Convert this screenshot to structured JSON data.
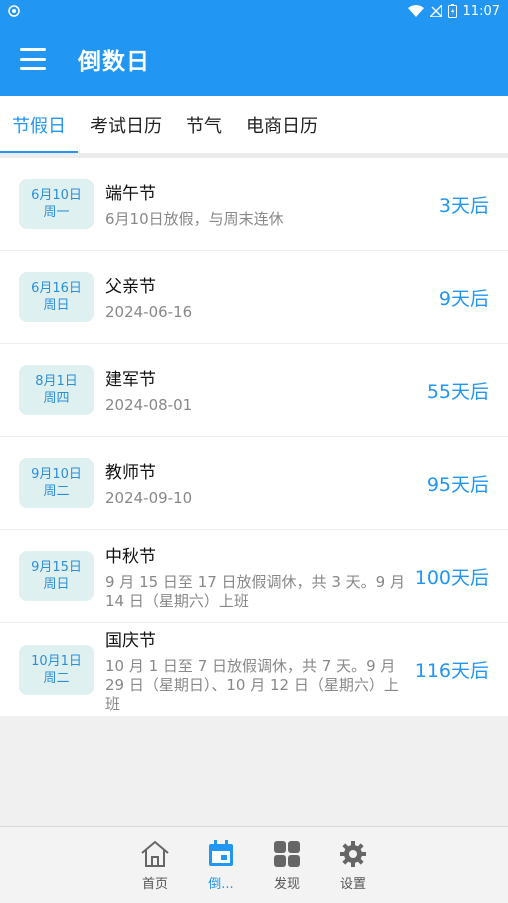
{
  "status": {
    "time": "11:07"
  },
  "app": {
    "title": "倒数日"
  },
  "tabs": [
    "节假日",
    "考试日历",
    "节气",
    "电商日历"
  ],
  "holidays": [
    {
      "date": "6月10日",
      "weekday": "周一",
      "name": "端午节",
      "desc": "6月10日放假，与周末连休",
      "days": "3天后"
    },
    {
      "date": "6月16日",
      "weekday": "周日",
      "name": "父亲节",
      "desc": "2024-06-16",
      "days": "9天后"
    },
    {
      "date": "8月1日",
      "weekday": "周四",
      "name": "建军节",
      "desc": "2024-08-01",
      "days": "55天后"
    },
    {
      "date": "9月10日",
      "weekday": "周二",
      "name": "教师节",
      "desc": "2024-09-10",
      "days": "95天后"
    },
    {
      "date": "9月15日",
      "weekday": "周日",
      "name": "中秋节",
      "desc": "9 月 15 日至 17 日放假调休，共 3 天。9 月 14 日（星期六）上班",
      "days": "100天后"
    },
    {
      "date": "10月1日",
      "weekday": "周二",
      "name": "国庆节",
      "desc": "10 月 1 日至 7 日放假调休，共 7 天。9 月 29 日（星期日）、10 月 12 日（星期六）上班",
      "days": "116天后"
    }
  ],
  "nav": [
    {
      "label": "首页",
      "icon": "home-icon"
    },
    {
      "label": "倒...",
      "icon": "calendar-icon"
    },
    {
      "label": "发现",
      "icon": "grid-icon"
    },
    {
      "label": "设置",
      "icon": "gear-icon"
    }
  ],
  "colors": {
    "primary": "#2196f3",
    "badge_bg": "#dff0f1"
  }
}
